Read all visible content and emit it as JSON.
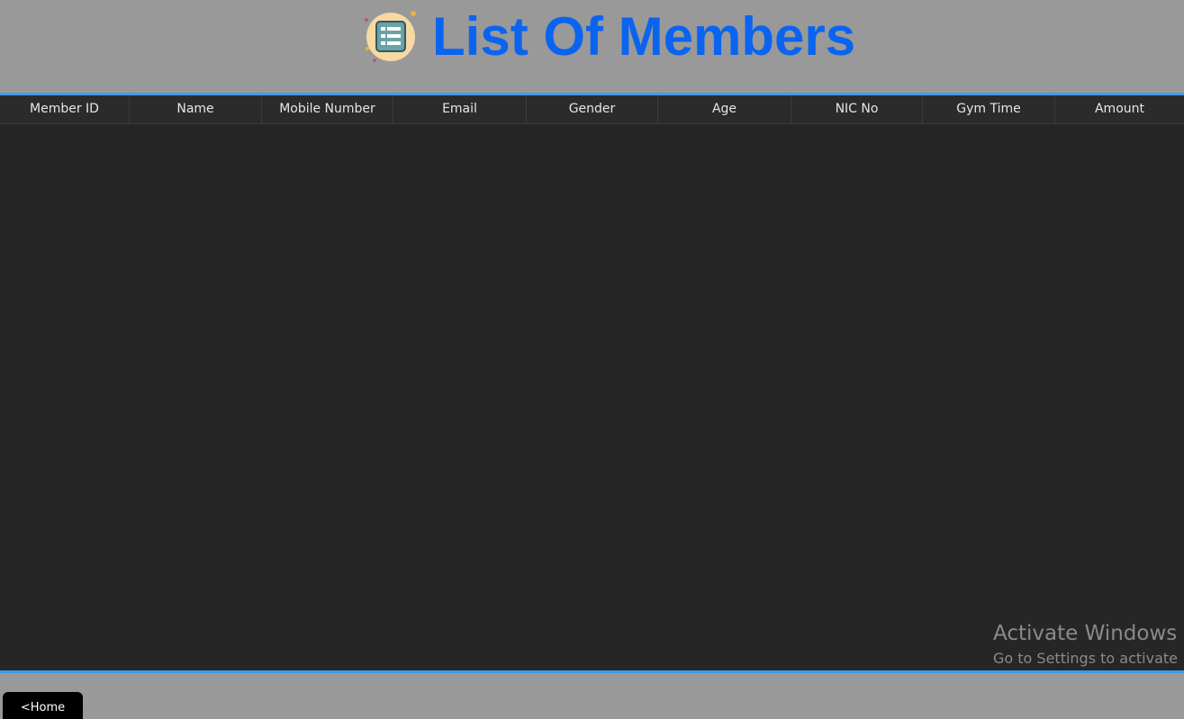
{
  "header": {
    "title": "List Of Members",
    "title_color": "#0a64f0",
    "logo_icon": "list-icon"
  },
  "table": {
    "columns": [
      "Member ID",
      "Name",
      "Mobile Number",
      "Email",
      "Gender",
      "Age",
      "NIC No",
      "Gym Time",
      "Amount"
    ],
    "rows": []
  },
  "watermark": {
    "title": "Activate Windows",
    "subtitle": "Go to Settings to activate"
  },
  "footer": {
    "home_label": "<Home"
  },
  "colors": {
    "background": "#999999",
    "table_bg": "#262626",
    "accent_border": "#3d9be9"
  }
}
